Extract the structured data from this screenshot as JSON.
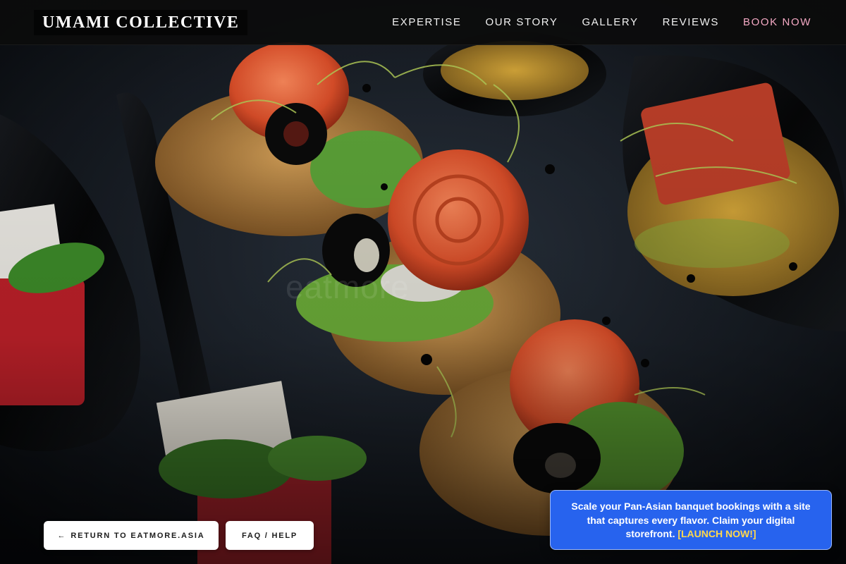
{
  "header": {
    "brand": "UMAMI COLLECTIVE",
    "nav": [
      {
        "label": "EXPERTISE"
      },
      {
        "label": "OUR STORY"
      },
      {
        "label": "GALLERY"
      },
      {
        "label": "REVIEWS"
      },
      {
        "label": "BOOK NOW"
      }
    ],
    "book_color": "#f4a9c4"
  },
  "hero": {
    "watermark": "eatmore"
  },
  "actions": {
    "return_arrow": "←",
    "return_label": "RETURN TO EATMORE.ASIA",
    "faq_label": "FAQ / HELP"
  },
  "promo": {
    "text": "Scale your Pan-Asian banquet bookings with a site that captures every flavor. Claim your digital storefront.",
    "cta": "[LAUNCH NOW!]",
    "bg_color": "#2763ee",
    "cta_color": "#ffd84d"
  }
}
